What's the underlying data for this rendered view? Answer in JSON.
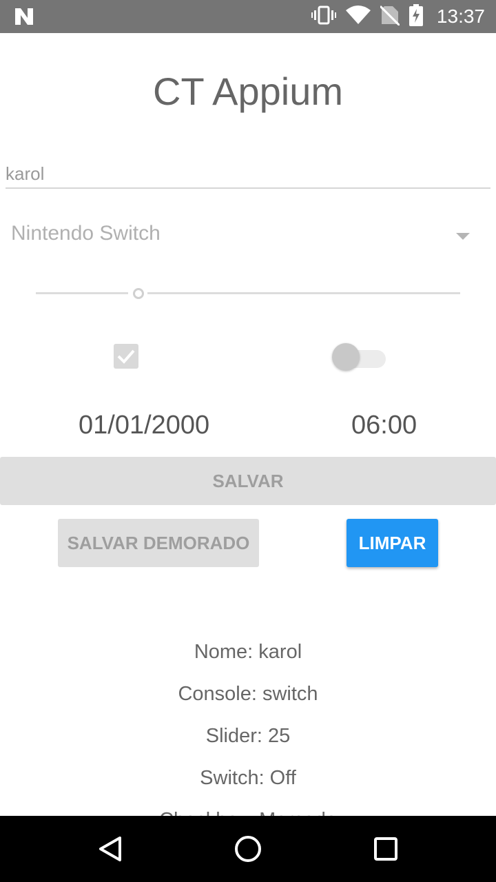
{
  "status_bar": {
    "time": "13:37",
    "icons": [
      "n-notification-icon",
      "vibrate-icon",
      "wifi-icon",
      "no-sim-icon",
      "battery-charging-icon"
    ]
  },
  "app": {
    "title": "CT Appium"
  },
  "form": {
    "name_value": "karol",
    "console_selected": "Nintendo Switch",
    "slider_value_fraction": 0.25,
    "checkbox_checked": true,
    "switch_on": false,
    "date": "01/01/2000",
    "time": "06:00"
  },
  "buttons": {
    "salvar": "SALVAR",
    "salvar_demorado": "SALVAR DEMORADO",
    "limpar": "LIMPAR"
  },
  "results": [
    "Nome: karol",
    "Console: switch",
    "Slider: 25",
    "Switch: Off",
    "Checkbox: Marcado"
  ],
  "colors": {
    "status_bar": "#757575",
    "primary_button": "#2196f3",
    "disabled_button": "#dfdfdf",
    "nav_bar": "#000000"
  }
}
